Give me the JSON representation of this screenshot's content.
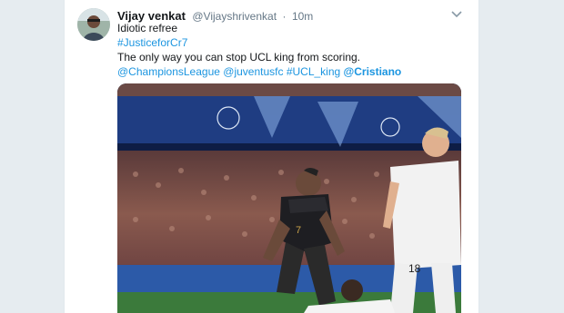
{
  "tweet": {
    "display_name": "Vijay venkat",
    "handle": "@Vijayshrivenkat",
    "separator": "·",
    "time": "10m",
    "line1": "Idiotic refree",
    "hashtag": "#JusticeforCr7",
    "line3": "The only way you can stop UCL king from scoring.",
    "mentions": [
      "@ChampionsLeague",
      "@juventusfc",
      "#UCL_king",
      "@Cristiano"
    ]
  },
  "media": {
    "player_left_number": "7",
    "player_right_number": "18"
  },
  "colors": {
    "link": "#1b95e0",
    "text": "#14171a",
    "muted": "#657786",
    "background": "#e6ecf0"
  },
  "icons": [
    "avatar-image",
    "chevron-down-icon"
  ]
}
